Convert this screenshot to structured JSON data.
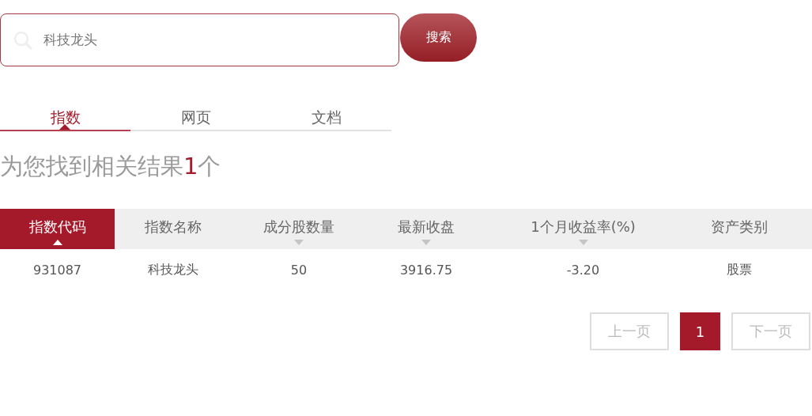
{
  "search": {
    "value": "科技龙头",
    "button": "搜索"
  },
  "tabs": [
    {
      "label": "指数",
      "selected": true
    },
    {
      "label": "网页",
      "selected": false
    },
    {
      "label": "文档",
      "selected": false
    }
  ],
  "result_summary": {
    "before": "为您找到相关结果",
    "count": "1",
    "after": "个"
  },
  "table": {
    "columns": [
      {
        "label": "指数代码",
        "selected": true,
        "sortable": true
      },
      {
        "label": "指数名称",
        "selected": false,
        "sortable": false
      },
      {
        "label": "成分股数量",
        "selected": false,
        "sortable": true
      },
      {
        "label": "最新收盘",
        "selected": false,
        "sortable": true
      },
      {
        "label": "1个月收益率(%)",
        "selected": false,
        "sortable": true
      },
      {
        "label": "资产类别",
        "selected": false,
        "sortable": false
      }
    ],
    "rows": [
      [
        "931087",
        "科技龙头",
        "50",
        "3916.75",
        "-3.20",
        "股票"
      ]
    ]
  },
  "pagination": [
    {
      "label": "上一页",
      "kind": "nav",
      "disabled": true,
      "selected": false
    },
    {
      "label": "1",
      "kind": "page",
      "disabled": false,
      "selected": true
    },
    {
      "label": "下一页",
      "kind": "nav",
      "disabled": true,
      "selected": false
    }
  ]
}
